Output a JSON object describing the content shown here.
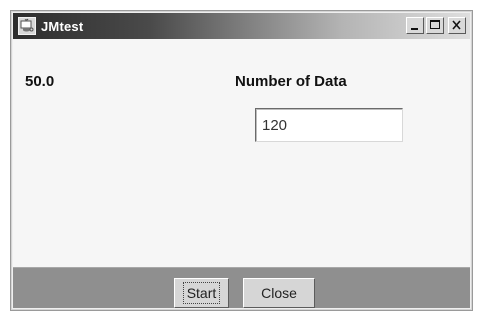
{
  "window": {
    "title": "JMtest",
    "controls": {
      "minimize": "minimize-icon",
      "maximize": "maximize-icon",
      "close": "close-icon"
    },
    "app_icon": "java-app-icon"
  },
  "main": {
    "value_label": "50.0",
    "field_label": "Number of Data",
    "data_input": {
      "value": "120",
      "placeholder": ""
    }
  },
  "buttons": {
    "start_label": "Start",
    "close_label": "Close"
  },
  "colors": {
    "title_gradient_start": "#2d2d2d",
    "title_gradient_end": "#dedede",
    "content_background": "#f6f6f6",
    "button_bar_background": "#8f8f8f",
    "button_face": "#d6d6d6"
  }
}
